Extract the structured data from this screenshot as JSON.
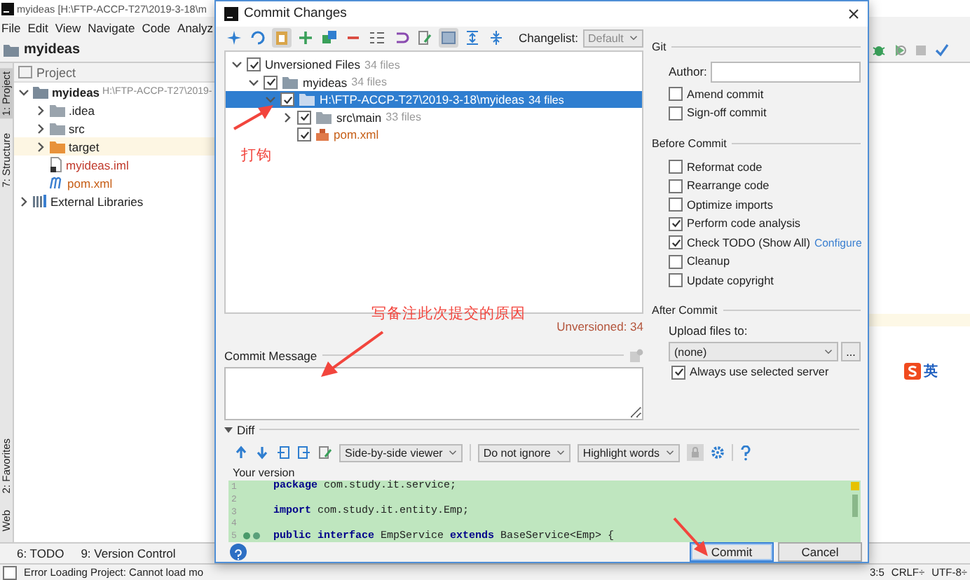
{
  "ide": {
    "title": "myideas [H:\\FTP-ACCP-T27\\2019-3-18\\m",
    "menu": [
      "File",
      "Edit",
      "View",
      "Navigate",
      "Code",
      "Analyz"
    ],
    "breadcrumb": "myideas",
    "side_tabs": [
      {
        "label": "1: Project",
        "selected": true
      },
      {
        "label": "7: Structure",
        "selected": false
      }
    ],
    "side_tabs_lower": [
      {
        "label": "2: Favorites"
      },
      {
        "label": "Web"
      }
    ],
    "project_panel": {
      "title": "Project",
      "tree": [
        {
          "name": "myideas",
          "detail": "H:\\FTP-ACCP-T27\\2019-",
          "kind": "module",
          "expanded": true,
          "selected": false,
          "children": [
            {
              "name": ".idea",
              "kind": "folder",
              "expanded": false,
              "selected": false
            },
            {
              "name": "src",
              "kind": "folder",
              "expanded": false,
              "selected": false
            },
            {
              "name": "target",
              "kind": "excluded",
              "expanded": false,
              "selected": true
            },
            {
              "name": "myideas.iml",
              "kind": "iml",
              "selected": false
            },
            {
              "name": "pom.xml",
              "kind": "maven",
              "selected": false
            }
          ]
        },
        {
          "name": "External Libraries",
          "kind": "library",
          "expanded": false,
          "selected": false
        }
      ]
    },
    "ime": "英",
    "bottom_tabs": [
      "6: TODO",
      "9: Version Control"
    ],
    "status_bar": {
      "message": "Error Loading Project: Cannot load mo",
      "position": "3:5",
      "line_separator": "CRLF÷",
      "encoding": "UTF-8÷"
    }
  },
  "dialog": {
    "title": "Commit Changes",
    "changelist": {
      "label": "Changelist:",
      "value": "Default"
    },
    "changes_tree": [
      {
        "label": "Unversioned Files",
        "count": "34 files",
        "checked": true,
        "expanded": true,
        "selected": false,
        "children": [
          {
            "label": "myideas",
            "count": "34 files",
            "kind": "module",
            "checked": true,
            "expanded": true,
            "selected": false,
            "children": [
              {
                "label": "H:\\FTP-ACCP-T27\\2019-3-18\\myideas",
                "count": "34 files",
                "kind": "folder",
                "checked": true,
                "expanded": true,
                "selected": true,
                "children": [
                  {
                    "label": "src\\main",
                    "count": "33 files",
                    "kind": "folder",
                    "checked": true,
                    "expanded": false,
                    "selected": false
                  },
                  {
                    "label": "pom.xml",
                    "kind": "file",
                    "checked": true,
                    "selected": false
                  }
                ]
              }
            ]
          }
        ]
      }
    ],
    "unversioned_summary": "Unversioned: 34",
    "commit_message_label": "Commit Message",
    "git": {
      "title": "Git",
      "author_label": "Author:",
      "options": [
        {
          "label": "Amend commit",
          "checked": false
        },
        {
          "label": "Sign-off commit",
          "checked": false
        }
      ]
    },
    "before_commit": {
      "title": "Before Commit",
      "options": [
        {
          "label": "Reformat code",
          "checked": false
        },
        {
          "label": "Rearrange code",
          "checked": false
        },
        {
          "label": "Optimize imports",
          "checked": false
        },
        {
          "label": "Perform code analysis",
          "checked": true
        },
        {
          "label": "Check TODO (Show All)",
          "checked": true,
          "link": "Configure"
        },
        {
          "label": "Cleanup",
          "checked": false
        },
        {
          "label": "Update copyright",
          "checked": false
        }
      ]
    },
    "after_commit": {
      "title": "After Commit",
      "upload_label": "Upload files to:",
      "server": "(none)",
      "browse": "...",
      "options": [
        {
          "label": "Always use selected server",
          "checked": true
        }
      ]
    },
    "diff": {
      "title": "Diff",
      "viewer": "Side-by-side viewer",
      "ignore": "Do not ignore",
      "highlight": "Highlight words",
      "version_label": "Your version",
      "lines": [
        {
          "number": "1",
          "code": "**package** com.study.it.service;"
        },
        {
          "number": "2"
        },
        {
          "number": "3",
          "code": "**import** com.study.it.entity.Emp;"
        },
        {
          "number": "4"
        },
        {
          "number": "5",
          "code": "**public interface** EmpService **extends** BaseService<Emp> {",
          "gutter_icons": true
        }
      ]
    },
    "buttons": [
      {
        "label": "Commit",
        "kind": "primary"
      },
      {
        "label": "Cancel",
        "kind": "secondary"
      }
    ]
  },
  "annotations": [
    {
      "text": "打钩"
    },
    {
      "text": "写备注此次提交的原因"
    }
  ]
}
